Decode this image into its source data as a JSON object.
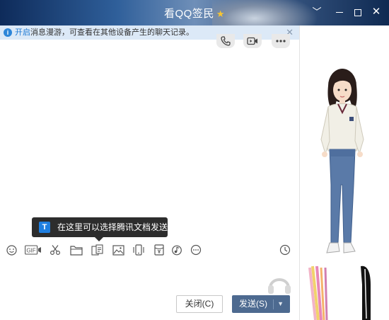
{
  "window": {
    "title": "看QQ签民",
    "controls": {
      "collapse": "﹀",
      "close": "✕"
    }
  },
  "notice": {
    "link": "开启",
    "text": "消息漫游，可查看在其他设备产生的聊天记录。",
    "dismiss": "✕"
  },
  "chat_actions": [
    {
      "name": "voice-call-icon"
    },
    {
      "name": "video-call-icon"
    },
    {
      "name": "more-icon"
    }
  ],
  "tooltip": {
    "text": "在这里可以选择腾讯文档发送",
    "icon_glyph": "T"
  },
  "toolbar": {
    "gif_label": "GIF",
    "items": [
      "emoji-icon",
      "gif-icon",
      "scissors-icon",
      "folder-icon",
      "tencent-doc-icon",
      "image-icon",
      "shake-icon",
      "red-packet-icon",
      "music-icon",
      "more-icon",
      "history-icon"
    ]
  },
  "buttons": {
    "close": "关闭(C)",
    "send": "发送(S)",
    "send_caret": "▼"
  },
  "colors": {
    "accent": "#1f7ad3",
    "send_button": "#4d6a90",
    "notice_bg": "#dce9f7"
  }
}
